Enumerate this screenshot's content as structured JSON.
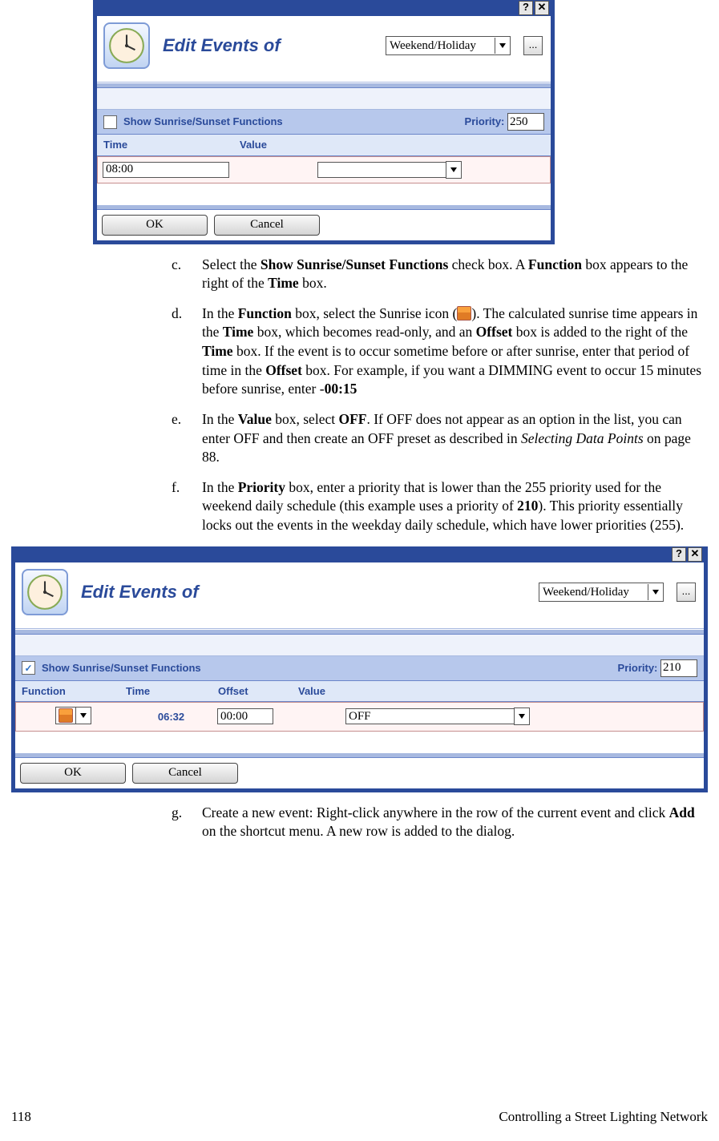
{
  "dlg1": {
    "title": "Edit Events of",
    "schedule_value": "Weekend/Holiday",
    "show_sun_label": "Show Sunrise/Sunset Functions",
    "show_sun_checked": false,
    "priority_label": "Priority:",
    "priority_value": "250",
    "cols": {
      "time": "Time",
      "value": "Value"
    },
    "row": {
      "time": "08:00",
      "value": ""
    },
    "ok": "OK",
    "cancel": "Cancel"
  },
  "dlg2": {
    "title": "Edit Events of",
    "schedule_value": "Weekend/Holiday",
    "show_sun_label": "Show Sunrise/Sunset Functions",
    "show_sun_checked": true,
    "priority_label": "Priority:",
    "priority_value": "210",
    "cols": {
      "func": "Function",
      "time": "Time",
      "offset": "Offset",
      "value": "Value"
    },
    "row": {
      "time": "06:32",
      "offset": "00:00",
      "value": "OFF"
    },
    "ok": "OK",
    "cancel": "Cancel"
  },
  "steps": {
    "c": {
      "mk": "c.",
      "t1": "Select the ",
      "b1": "Show Sunrise/Sunset Functions",
      "t2": " check box.  A ",
      "b2": "Function",
      "t3": " box appears to the right of the ",
      "b3": "Time",
      "t4": " box."
    },
    "d": {
      "mk": "d.",
      "t1": "In the ",
      "b1": "Function",
      "t2": " box, select the Sunrise icon (",
      "t3": ").  The calculated sunrise time appears in the ",
      "b2": "Time",
      "t4": " box, which becomes read-only, and an ",
      "b3": "Offset",
      "t5": " box is added to the right of the ",
      "b4": "Time",
      "t6": " box.  If the event is to occur sometime before or after sunrise, enter that period of time in the ",
      "b5": "Offset",
      "t7": " box.  For example, if you want a DIMMING event to occur 15 minutes before sunrise, enter -",
      "b6": "00:15"
    },
    "e": {
      "mk": "e.",
      "t1": "In the ",
      "b1": "Value",
      "t2": " box, select ",
      "b2": "OFF",
      "t3": ".  If OFF does not appear as an option in the list, you can enter OFF and then create an OFF preset as described in ",
      "i1": "Selecting Data Points",
      "t4": " on page 88."
    },
    "f": {
      "mk": "f.",
      "t1": "In the ",
      "b1": "Priority",
      "t2": " box, enter a priority that is lower than the 255 priority used for the weekend daily schedule (this example uses a priority of ",
      "b2": "210",
      "t3": ").  This priority essentially locks out the events in the weekday daily schedule, which have lower priorities (255)."
    },
    "g": {
      "mk": "g.",
      "t1": "Create a new event:  Right-click anywhere in the row of the current event and click ",
      "b1": "Add",
      "t2": " on the shortcut menu.  A new row is added to the dialog."
    }
  },
  "footer": {
    "page": "118",
    "title": "Controlling a Street Lighting Network"
  }
}
